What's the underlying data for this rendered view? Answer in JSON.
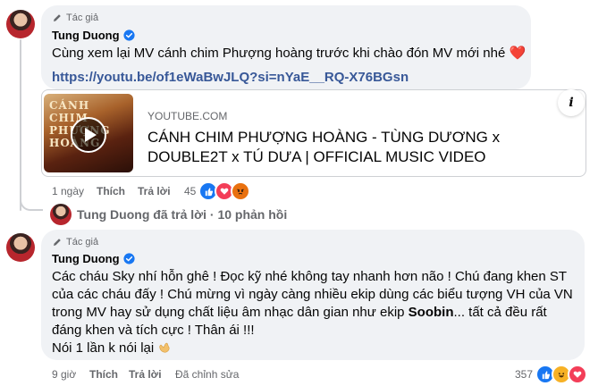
{
  "comment1": {
    "author_tag": "Tác giả",
    "author_name": "Tung Duong",
    "text": "Cùng xem lại MV cánh chim Phượng hoàng trước khi chào đón MV mới nhé ❤️",
    "link": "https://youtu.be/of1eWaBwJLQ?si=nYaE__RQ-X76BGsn",
    "preview": {
      "domain": "YOUTUBE.COM",
      "title": "CÁNH CHIM PHƯỢNG HOÀNG - TÙNG DƯƠNG x DOUBLE2T x TÚ DƯA | OFFICIAL MUSIC VIDEO",
      "thumb_text": "CÁNH CHIM PHƯỢNG HOÀNG"
    },
    "info_icon": "i",
    "actions": {
      "time": "1 ngày",
      "like": "Thích",
      "reply": "Trả lời"
    },
    "reactions": {
      "count": "45",
      "icons": [
        "like-icon",
        "love-icon",
        "angry-icon"
      ]
    }
  },
  "replies_summary": "Tung Duong đã trả lời · 10 phản hồi",
  "comment2": {
    "author_tag": "Tác giả",
    "author_name": "Tung Duong",
    "lines": [
      "Các cháu Sky nhí hỗn ghê ! Đọc kỹ nhé không tay nhanh hơn não ! Chú đang khen ST",
      "của các cháu đấy ! Chú mừng vì ngày càng nhiều ekip dùng các biểu tượng VH của VN",
      "trong MV hay sử dụng chất liệu âm nhạc dân gian như ekip",
      "Soobin",
      "... tất cả đều rất",
      "đáng khen và tích cực ! Thân ái !!!",
      "Nói 1 lần k nói lại"
    ],
    "actions": {
      "time": "9 giờ",
      "like": "Thích",
      "reply": "Trả lời",
      "edited": "Đã chỉnh sửa"
    },
    "reactions": {
      "count": "357",
      "icons": [
        "like-icon",
        "haha-icon",
        "love-icon"
      ]
    }
  },
  "colors": {
    "accent": "#1877f2",
    "link": "#385898",
    "bubble": "#f0f2f5",
    "muted": "#65676b"
  }
}
